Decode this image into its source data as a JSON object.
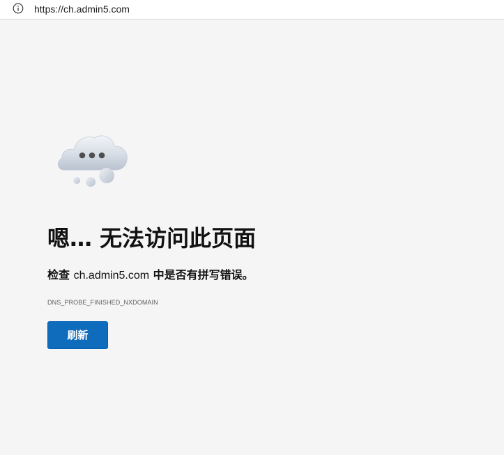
{
  "address_bar": {
    "url": "https://ch.admin5.com"
  },
  "error": {
    "title": "嗯… 无法访问此页面",
    "description_prefix": "检查 ",
    "domain": "ch.admin5.com",
    "description_suffix": " 中是否有拼写错误。",
    "code": "DNS_PROBE_FINISHED_NXDOMAIN"
  },
  "actions": {
    "refresh_label": "刷新"
  },
  "icons": {
    "site_info": "info-icon",
    "illustration": "cloud-icon"
  },
  "colors": {
    "page_background": "#f5f5f5",
    "button_background": "#0f6cbd",
    "button_text": "#ffffff"
  }
}
